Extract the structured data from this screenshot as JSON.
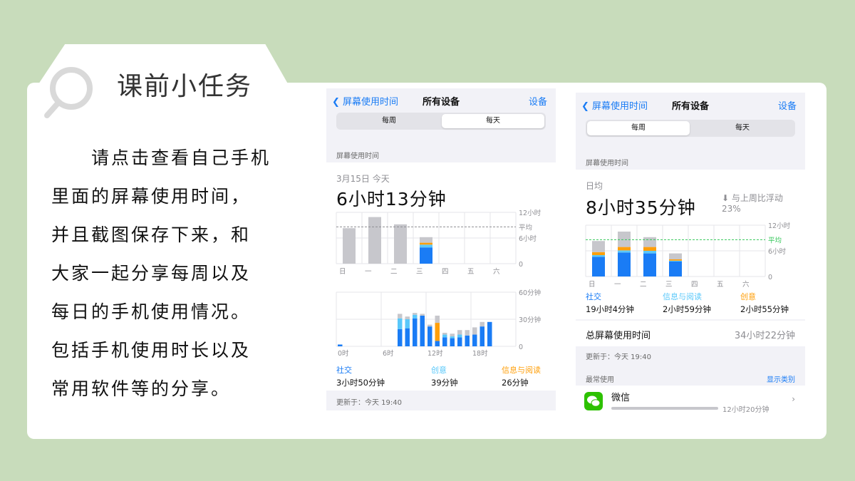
{
  "slide": {
    "title": "课前小任务",
    "body_lines": [
      "　　请点击查看自己手机",
      "里面的屏幕使用时间，",
      "并且截图保存下来，和",
      "大家一起分享每周以及",
      "每日的手机使用情况。",
      "包括手机使用时长以及",
      "常用软件等的分享。"
    ]
  },
  "colors": {
    "background": "#c8dcbb",
    "social": "#1a7cf5",
    "creative": "#5ac8fa",
    "reading": "#ff9f0a",
    "other": "#c7c7cc",
    "accent": "#1a7cf5",
    "average_line": "#34c759"
  },
  "daily_screen": {
    "nav": {
      "back": "屏幕使用时间",
      "title": "所有设备",
      "right": "设备"
    },
    "segments": [
      "每周",
      "每天"
    ],
    "active_segment": "每天",
    "section_label": "屏幕使用时间",
    "date": "3月15日 今天",
    "total": "6小时13分钟",
    "legend": [
      {
        "name": "社交",
        "value": "3小时50分钟",
        "color": "#1a7cf5"
      },
      {
        "name": "创意",
        "value": "39分钟",
        "color": "#5ac8fa"
      },
      {
        "name": "信息与阅读",
        "value": "26分钟",
        "color": "#ff9f0a"
      }
    ],
    "updated": "更新于：今天 19:40"
  },
  "weekly_screen": {
    "nav": {
      "back": "屏幕使用时间",
      "title": "所有设备",
      "right": "设备"
    },
    "segments": [
      "每周",
      "每天"
    ],
    "active_segment": "每周",
    "section_label": "屏幕使用时间",
    "average_label": "日均",
    "total": "8小时35分钟",
    "change_text": "与上周比浮动",
    "change_value": "23%",
    "legend": [
      {
        "name": "社交",
        "value": "19小时4分钟",
        "color": "#1a7cf5"
      },
      {
        "name": "信息与阅读",
        "value": "2小时59分钟",
        "color": "#5ac8fa"
      },
      {
        "name": "创意",
        "value": "2小时55分钟",
        "color": "#ff9f0a"
      }
    ],
    "total_label": "总屏幕使用时间",
    "total_value": "34小时22分钟",
    "updated": "更新于：今天 19:40",
    "most_used_label": "最常使用",
    "show_categories": "显示类别",
    "app_name": "微信",
    "app_time": "12小时20分钟"
  },
  "chart_data": [
    {
      "type": "bar",
      "name_note": "daily screen: usage per weekday",
      "categories": [
        "日",
        "一",
        "二",
        "三",
        "四",
        "五",
        "六"
      ],
      "y_ticks": [
        "12小时",
        "6小时",
        "0"
      ],
      "average_label": "平均",
      "average_hours": 8.6,
      "series": [
        {
          "values": [
            0,
            0,
            0,
            3.8
          ]
        },
        {
          "values": [
            0,
            0,
            0,
            0.65
          ]
        },
        {
          "values": [
            0,
            0,
            0,
            0.45
          ]
        },
        {
          "values": [
            8.3,
            10.9,
            9.2,
            1.3
          ]
        }
      ],
      "ylim": [
        0,
        12
      ]
    },
    {
      "type": "bar",
      "name_note": "daily screen: minutes per hour",
      "x_ticks": [
        "0时",
        "6时",
        "12时",
        "18时"
      ],
      "y_ticks": [
        "60分钟",
        "30分钟",
        "0"
      ],
      "ylim": [
        0,
        60
      ],
      "hours": [
        0,
        1,
        2,
        3,
        4,
        5,
        6,
        7,
        8,
        9,
        10,
        11,
        12,
        13,
        14,
        15,
        16,
        17,
        18,
        19,
        20,
        21,
        22,
        23
      ],
      "social": [
        2,
        0,
        0,
        0,
        0,
        0,
        0,
        0,
        19,
        20,
        31,
        34,
        22,
        6,
        10,
        9,
        10,
        12,
        13,
        22,
        27,
        0,
        0,
        0
      ],
      "creative": [
        0,
        0,
        0,
        0,
        0,
        0,
        0,
        0,
        12,
        10,
        4,
        0,
        0,
        0,
        3,
        2,
        3,
        0,
        0,
        0,
        0,
        0,
        0,
        0
      ],
      "reading": [
        0,
        0,
        0,
        0,
        0,
        0,
        0,
        0,
        0,
        0,
        0,
        0,
        0,
        20,
        0,
        0,
        0,
        0,
        0,
        0,
        0,
        0,
        0,
        0
      ],
      "other": [
        0,
        0,
        0,
        0,
        0,
        0,
        0,
        0,
        5,
        3,
        2,
        2,
        2,
        8,
        2,
        3,
        5,
        6,
        8,
        5,
        0,
        0,
        0,
        0
      ]
    },
    {
      "type": "bar",
      "name_note": "weekly screen: usage per weekday",
      "categories": [
        "日",
        "一",
        "二",
        "三",
        "四",
        "五",
        "六"
      ],
      "y_ticks": [
        "12小时",
        "6小时",
        "0"
      ],
      "average_label": "平均",
      "average_hours": 8.6,
      "series": [
        {
          "values": [
            4.6,
            5.6,
            5.4,
            3.5,
            0,
            0,
            0
          ]
        },
        {
          "values": [
            0.4,
            0.5,
            0.6,
            0.2,
            0,
            0,
            0
          ]
        },
        {
          "values": [
            0.7,
            0.8,
            0.9,
            0.3,
            0,
            0,
            0
          ]
        },
        {
          "values": [
            2.6,
            3.6,
            2.3,
            1.4,
            0,
            0,
            0
          ]
        }
      ],
      "ylim": [
        0,
        12
      ]
    }
  ]
}
